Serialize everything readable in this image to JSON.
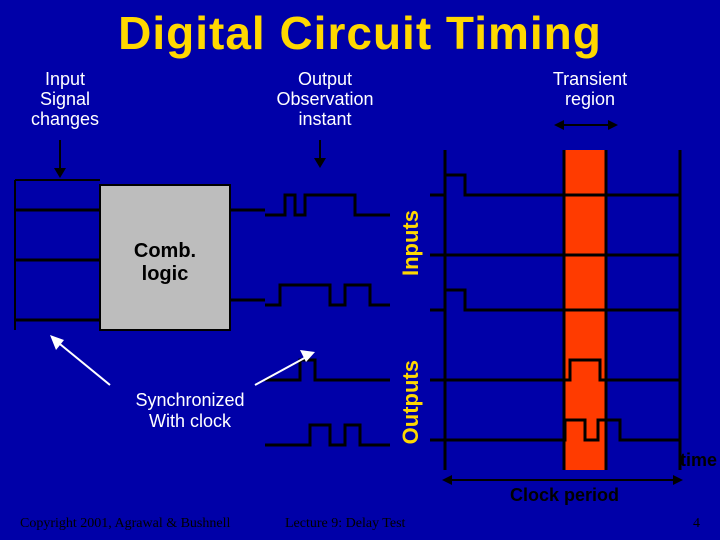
{
  "title": "Digital Circuit Timing",
  "labels": {
    "input_signal_changes": "Input\nSignal\nchanges",
    "output_observation": "Output\nObservation\ninstant",
    "transient_region": "Transient\nregion",
    "comb_logic": "Comb.\nlogic",
    "sync_clock": "Synchronized\nWith clock",
    "inputs_axis": "Inputs",
    "outputs_axis": "Outputs",
    "time_axis": "time",
    "clock_period": "Clock period"
  },
  "footer": {
    "copyright": "Copyright 2001, Agrawal & Bushnell",
    "lecture": "Lecture 9: Delay Test",
    "page": "4"
  },
  "colors": {
    "bg": "#0000A8",
    "accent": "#FFD800",
    "block": "#BDBDBD",
    "highlight": "#FF3B00"
  }
}
